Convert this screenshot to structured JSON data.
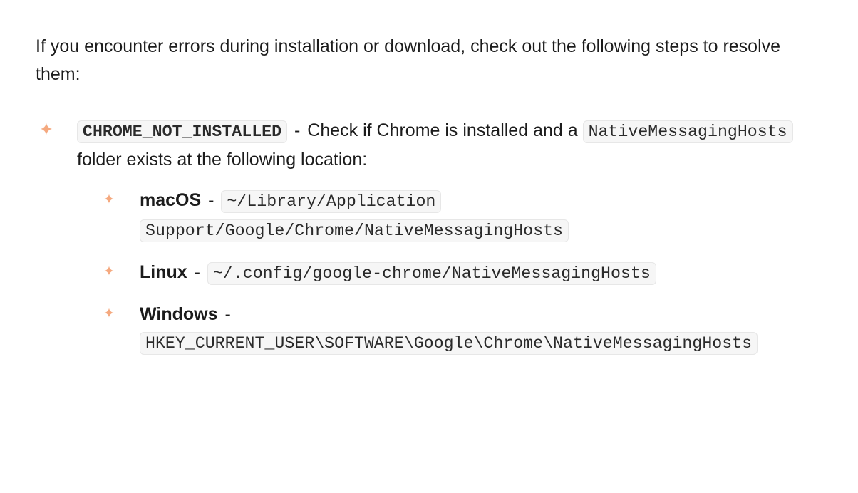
{
  "intro": "If you encounter errors during installation or download, check out the following steps to resolve them:",
  "item": {
    "code": "CHROME_NOT_INSTALLED",
    "dash1": " - ",
    "text1": "Check if Chrome is installed and a ",
    "code2": "NativeMessagingHosts",
    "text2": " folder exists at the following location:"
  },
  "os": {
    "mac": {
      "label": "macOS",
      "dash": " - ",
      "path": "~/Library/Application Support/Google/Chrome/NativeMessagingHosts"
    },
    "linux": {
      "label": "Linux",
      "dash": " - ",
      "path": "~/.config/google-chrome/NativeMessagingHosts"
    },
    "windows": {
      "label": "Windows",
      "dash": " - ",
      "path": "HKEY_CURRENT_USER\\SOFTWARE\\Google\\Chrome\\NativeMessagingHosts"
    }
  }
}
